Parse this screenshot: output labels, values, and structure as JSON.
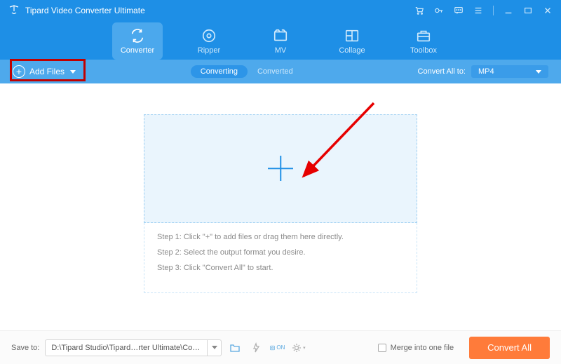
{
  "title": "Tipard Video Converter Ultimate",
  "tabs": {
    "converter": "Converter",
    "ripper": "Ripper",
    "mv": "MV",
    "collage": "Collage",
    "toolbox": "Toolbox"
  },
  "subbar": {
    "add_files": "Add Files",
    "converting": "Converting",
    "converted": "Converted",
    "convert_all_to": "Convert All to:",
    "format": "MP4"
  },
  "steps": {
    "s1": "Step 1: Click \"+\" to add files or drag them here directly.",
    "s2": "Step 2: Select the output format you desire.",
    "s3": "Step 3: Click \"Convert All\" to start."
  },
  "bottombar": {
    "save_to": "Save to:",
    "path": "D:\\Tipard Studio\\Tipard…rter Ultimate\\Converted",
    "merge": "Merge into one file",
    "convert_all": "Convert All"
  }
}
